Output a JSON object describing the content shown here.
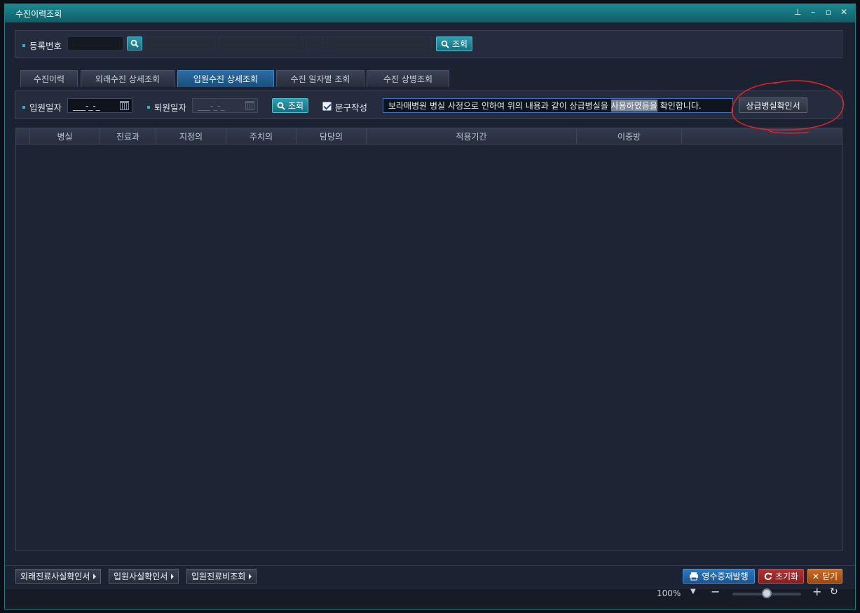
{
  "window": {
    "title": "수진이력조회",
    "controls": {
      "pin": "⊥",
      "minimize": "–",
      "maximize": "▫",
      "close": "✕"
    }
  },
  "top_search": {
    "reg_label": "등록번호",
    "query_label": "조회"
  },
  "tabs": [
    {
      "label": "수진이력"
    },
    {
      "label": "외래수진 상세조회"
    },
    {
      "label": "입원수진 상세조회"
    },
    {
      "label": "수진 일자별 조회"
    },
    {
      "label": "수진 상병조회"
    }
  ],
  "filter": {
    "admit_label": "입원일자",
    "admit_value": "___-_-_",
    "discharge_label": "퇴원일자",
    "discharge_value": "___-_-_",
    "query_label": "조회",
    "phrase_check_label": "문구작성",
    "phrase_prefix": "보라매병원 병실 사정으로 인하여 위의 내용과 같이 상급병실을",
    "phrase_highlight": "사용하였음을",
    "phrase_suffix": "확인합니다.",
    "confirm_button": "상급병실확인서"
  },
  "grid": {
    "columns": [
      "",
      "병실",
      "진료과",
      "지정의",
      "주치의",
      "담당의",
      "적용기간",
      "이중방"
    ]
  },
  "bottom": {
    "left_buttons": [
      "외래진료사실확인서",
      "입원사실확인서",
      "입원진료비조회"
    ],
    "receipt_button": "영수증재발행",
    "reset_button": "초기화",
    "close_button": "닫기"
  },
  "status": {
    "zoom": "100%",
    "zoom_level": 0.5
  },
  "colors": {
    "accent": "#1c8790",
    "tab_active": "#2b6ca2",
    "reset_red": "#9a2a2a",
    "close_orange": "#b5591c",
    "receipt_blue": "#1f5f9e",
    "annotation_red": "#e0212a"
  }
}
